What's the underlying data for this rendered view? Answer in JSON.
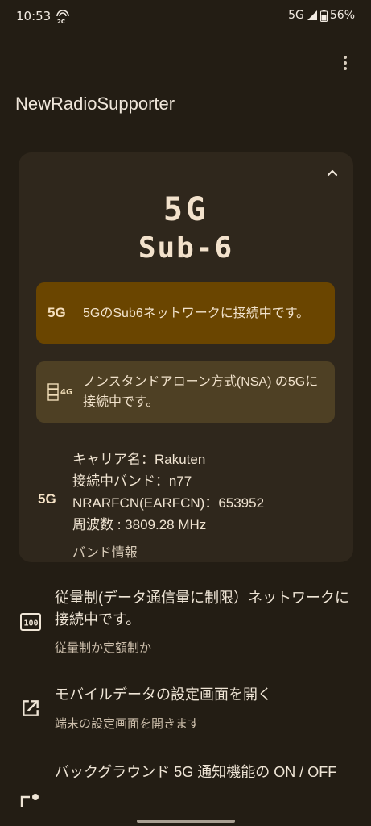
{
  "status": {
    "time": "10:53",
    "left_badge_icon": "2c-hotspot-icon",
    "network": "5G",
    "battery": "56%"
  },
  "app": {
    "title": "NewRadioSupporter",
    "menu_icon": "more-vert-icon"
  },
  "card": {
    "generation": "5G",
    "network_type": "Sub-6",
    "messages": [
      {
        "icon": "5g-badge-icon",
        "icon_text": "5G",
        "text": "5GのSub6ネットワークに接続中です。"
      },
      {
        "icon": "nsa-5g-4g-icon",
        "icon_text": "4G",
        "text": "ノンスタンドアローン方式(NSA) の5Gに接続中です。"
      }
    ],
    "details": {
      "icon_text": "5G",
      "carrier": "キャリア名：Rakuten",
      "band": "接続中バンド：n77",
      "nrarfcn": "NRARFCN(EARFCN)：653952",
      "frequency": "周波数 : 3809.28 MHz",
      "band_info_link": "バンド情報"
    }
  },
  "list": [
    {
      "icon": "metered-100-icon",
      "title": "従量制(データ通信量に制限）ネットワークに接続中です。",
      "subtitle": "従量制か定額制か"
    },
    {
      "icon": "open-external-icon",
      "title": "モバイルデータの設定画面を開く",
      "subtitle": "端末の設定画面を開きます"
    },
    {
      "icon": "background-toggle-icon",
      "title": "バックグラウンド 5G 通知機能の ON / OFF",
      "subtitle": ""
    }
  ],
  "colors": {
    "background": "#231d14",
    "card": "#2f271c",
    "highlight_box": "#6a4500",
    "secondary_box": "#4e4024"
  }
}
